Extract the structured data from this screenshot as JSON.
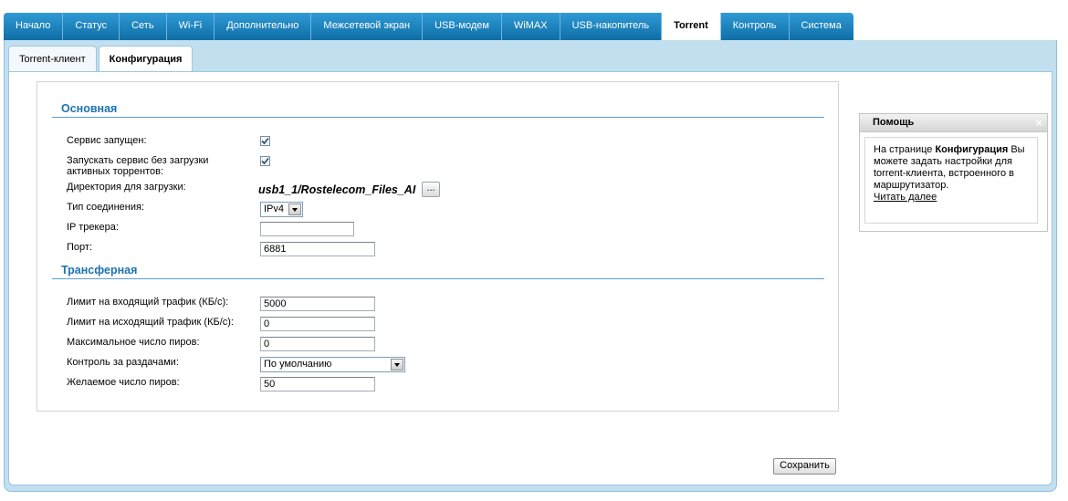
{
  "top_tabs": [
    {
      "label": "Начало"
    },
    {
      "label": "Статус"
    },
    {
      "label": "Сеть"
    },
    {
      "label": "Wi-Fi"
    },
    {
      "label": "Дополнительно"
    },
    {
      "label": "Межсетевой экран"
    },
    {
      "label": "USB-модем"
    },
    {
      "label": "WiMAX"
    },
    {
      "label": "USB-накопитель"
    },
    {
      "label": "Torrent",
      "active": true
    },
    {
      "label": "Контроль"
    },
    {
      "label": "Система"
    }
  ],
  "sub_tabs": [
    {
      "label": "Torrent-клиент"
    },
    {
      "label": "Конфигурация",
      "active": true
    }
  ],
  "basic": {
    "title": "Основная",
    "service_running_label": "Сервис запущен:",
    "service_running_checked": true,
    "start_without_active_label_1": "Запускать сервис без загрузки",
    "start_without_active_label_2": "активных торрентов:",
    "start_without_active_checked": true,
    "download_dir_label": "Директория для загрузки:",
    "download_dir_value": "usb1_1/Rostelecom_Files_AI",
    "browse_label": "...",
    "connection_type_label": "Тип соединения:",
    "connection_type_value": "IPv4",
    "tracker_ip_label": "IP трекера:",
    "tracker_ip_value": "",
    "port_label": "Порт:",
    "port_value": "6881"
  },
  "transfer": {
    "title": "Трансферная",
    "download_limit_label": "Лимит на входящий трафик (КБ/с):",
    "download_limit_value": "5000",
    "upload_limit_label": "Лимит на исходящий трафик (КБ/с):",
    "upload_limit_value": "0",
    "max_peers_label": "Максимальное число пиров:",
    "max_peers_value": "0",
    "seeding_control_label": "Контроль за раздачами:",
    "seeding_control_value": "По умолчанию",
    "desired_peers_label": "Желаемое число пиров:",
    "desired_peers_value": "50"
  },
  "save_label": "Сохранить",
  "help": {
    "title": "Помощь",
    "close_glyph": "×",
    "text_prefix": "На странице ",
    "text_bold": "Конфигурация",
    "text_rest": " Вы можете задать настройки для torrent-клиента, встроенного в маршрутизатор.",
    "read_more": "Читать далее"
  },
  "colors": {
    "tab_blue": "#1a7fbc",
    "frame_blue": "#c2dff0",
    "section_title": "#1b72b3"
  }
}
